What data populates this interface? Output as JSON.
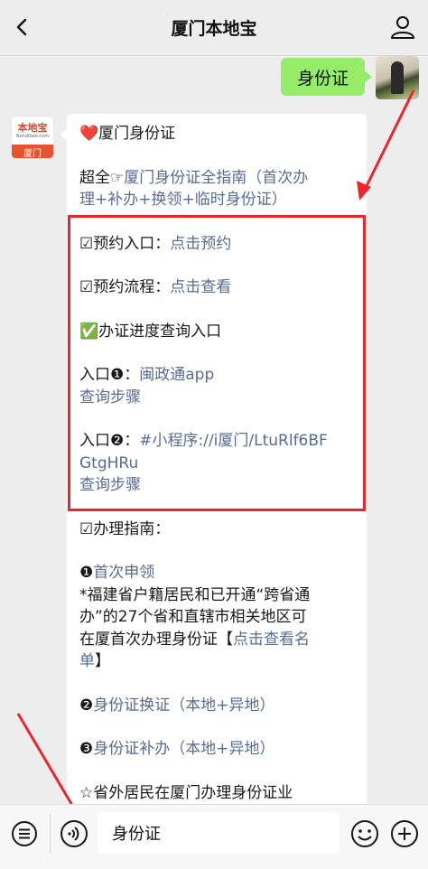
{
  "navbar": {
    "title": "厦门本地宝",
    "back_icon": "chevron-left-icon",
    "profile_icon": "user-icon"
  },
  "outgoing": {
    "text": "身份证"
  },
  "official_avatar": {
    "brand": "本地宝",
    "domain": "Bendibao.com",
    "city": "厦门"
  },
  "reply": {
    "heart": "❤️",
    "title": "厦门身份证",
    "intro_prefix": "超全☞",
    "intro_link_1": "厦门身份证全指南（首次办",
    "intro_link_2": "理+补办+换领+临时身份证）",
    "appt_label": "☑预约入口：",
    "appt_link": "点击预约",
    "process_label": "☑预约流程：",
    "process_link": "点击查看",
    "progress_check": "✅",
    "progress_label": "办证进度查询入口",
    "entry1_label": "入口❶：",
    "entry1_link": "闽政通app",
    "entry1_steps": "查询步骤",
    "entry2_label": "入口❷：",
    "entry2_link_1": "#小程序://i厦门/LtuRlf6BF",
    "entry2_link_2": "GtgHRu",
    "entry2_steps": "查询步骤",
    "guide_label": "☑办理指南：",
    "first_num": "❶",
    "first_link": "首次申领",
    "first_note_1": "*福建省户籍居民和已开通“跨省通",
    "first_note_2": "办”的27个省和直辖市相关地区可",
    "first_note_3_prefix": "在厦首次办理身份证【",
    "first_note_3_link": "点击查看名",
    "first_note_4_link": "单",
    "first_note_4_suffix": "】",
    "renew_num": "❷",
    "renew_link": "身份证换证（本地+异地）",
    "reissue_num": "❸",
    "reissue_link": "身份证补办（本地+异地）",
    "outside_text": "☆省外居民在厦门办理身份证业"
  },
  "bottombar": {
    "input_value": "身份证",
    "menu_icon": "list-menu-icon",
    "voice_icon": "voice-icon",
    "emoji_icon": "emoji-icon",
    "plus_icon": "plus-icon"
  },
  "colors": {
    "link": "#576b95",
    "sent_bubble": "#95ec69",
    "highlight": "#e8262b"
  }
}
